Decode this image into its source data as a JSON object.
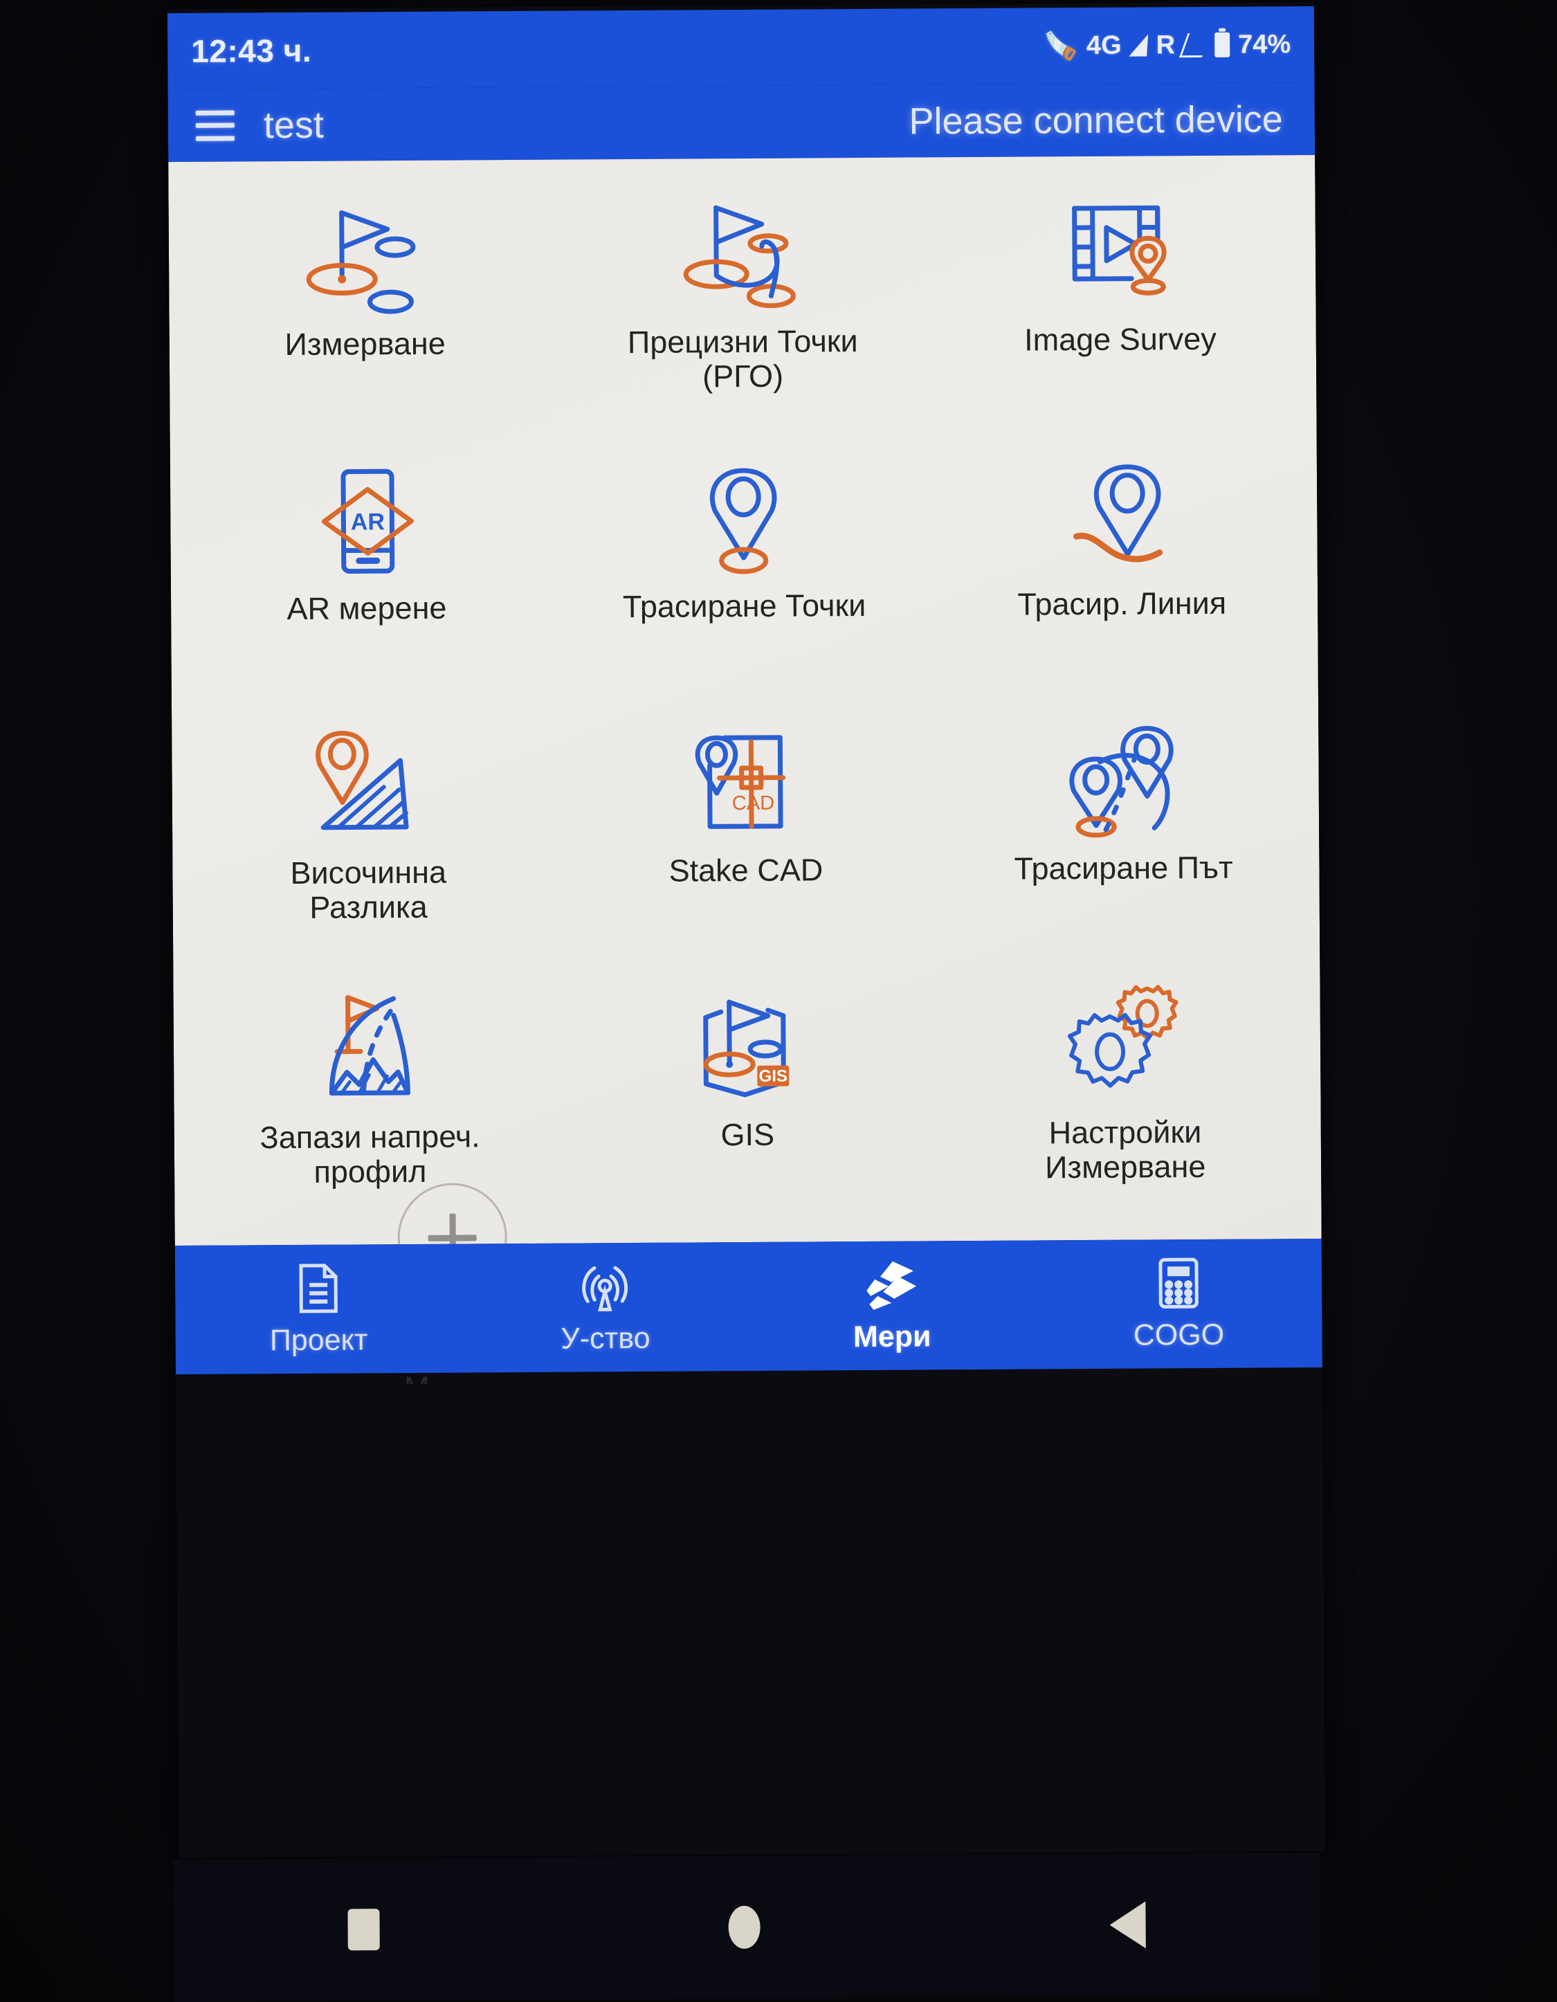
{
  "status_bar": {
    "time": "12:43 ч.",
    "bluetooth_icon": "bluetooth-icon",
    "network": "4G",
    "roaming": "R",
    "battery": "74%"
  },
  "app_bar": {
    "menu_icon": "hamburger-menu-icon",
    "project_name": "test",
    "connection_status": "Please connect device"
  },
  "colors": {
    "primary_blue": "#1b50d8",
    "icon_blue": "#2a5fd1",
    "icon_orange": "#d86a2c",
    "content_bg": "#eceae6"
  },
  "grid": {
    "items": [
      {
        "label": "Измерване",
        "icon": "flag-survey-icon"
      },
      {
        "label": "Прецизни Точки\n(РГО)",
        "icon": "flag-path-points-icon"
      },
      {
        "label": "Image Survey",
        "icon": "film-strip-pin-icon"
      },
      {
        "label": "AR мерене",
        "icon": "ar-phone-icon"
      },
      {
        "label": "Трасиране Точки",
        "icon": "pin-ellipse-icon"
      },
      {
        "label": "Трасир. Линия",
        "icon": "pin-curve-line-icon"
      },
      {
        "label": "Височинна\nРазлика",
        "icon": "pin-slope-icon"
      },
      {
        "label": "Stake CAD",
        "icon": "cad-crosshair-icon"
      },
      {
        "label": "Трасиране Път",
        "icon": "two-pins-road-icon"
      },
      {
        "label": "Запази напреч.\nпрофил",
        "icon": "cross-section-flag-icon"
      },
      {
        "label": "GIS",
        "icon": "map-flag-gis-icon"
      },
      {
        "label": "Настройки\nИзмерване",
        "icon": "double-gear-icon"
      }
    ]
  },
  "fab": {
    "label": "+",
    "icon": "add-plus-icon"
  },
  "partial_text": "М",
  "bottom_nav": {
    "items": [
      {
        "label": "Проект",
        "icon": "document-icon",
        "active": false
      },
      {
        "label": "У-ство",
        "icon": "antenna-icon",
        "active": false
      },
      {
        "label": "Мери",
        "icon": "layers-icon",
        "active": true
      },
      {
        "label": "COGO",
        "icon": "calculator-icon",
        "active": false
      }
    ]
  },
  "system_nav": {
    "recents_icon": "square-recents-icon",
    "home_icon": "circle-home-icon",
    "back_icon": "triangle-back-icon"
  }
}
